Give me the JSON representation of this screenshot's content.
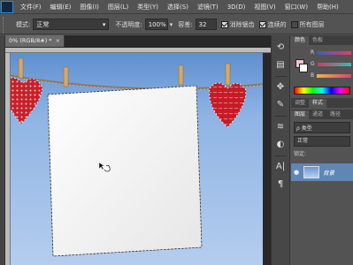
{
  "menu": [
    "文件(F)",
    "编辑(E)",
    "图像(I)",
    "图层(L)",
    "类型(Y)",
    "选择(S)",
    "滤镜(T)",
    "3D(D)",
    "视图(V)",
    "窗口(W)",
    "帮助(H)"
  ],
  "options": {
    "mode_label": "模式:",
    "mode_value": "正常",
    "opacity_label": "不透明度:",
    "opacity_value": "100%",
    "tolerance_label": "容差:",
    "tolerance_value": "32",
    "antialias_label": "消除锯齿",
    "contiguous_label": "连续的",
    "all_layers_label": "所有图层"
  },
  "document": {
    "tab_title": "0% (RGB/8#) *",
    "tab_close": "×"
  },
  "tools_right": [
    "⟲",
    "▤",
    "✥",
    "✎",
    "≋",
    "◐",
    "A|",
    "¶"
  ],
  "panels": {
    "color_tabs": [
      "颜色",
      "色板"
    ],
    "slider_labels": [
      "R",
      "G",
      "B"
    ],
    "layer_tabs": [
      "调整",
      "样式"
    ],
    "layer_tabs2": [
      "图层",
      "通道",
      "路径"
    ],
    "filter_label": "ρ 类型",
    "blend_mode": "正常",
    "lock_label": "锁定:",
    "layer_name": "背景",
    "colors": {
      "r": "#e0406a",
      "g": "#3cb8b0",
      "b": "#e7b84a",
      "layer_highlight": "#5f86b5"
    }
  },
  "icons": {
    "eye": "eye-icon",
    "cursor": "magic-wand-cursor-icon"
  }
}
